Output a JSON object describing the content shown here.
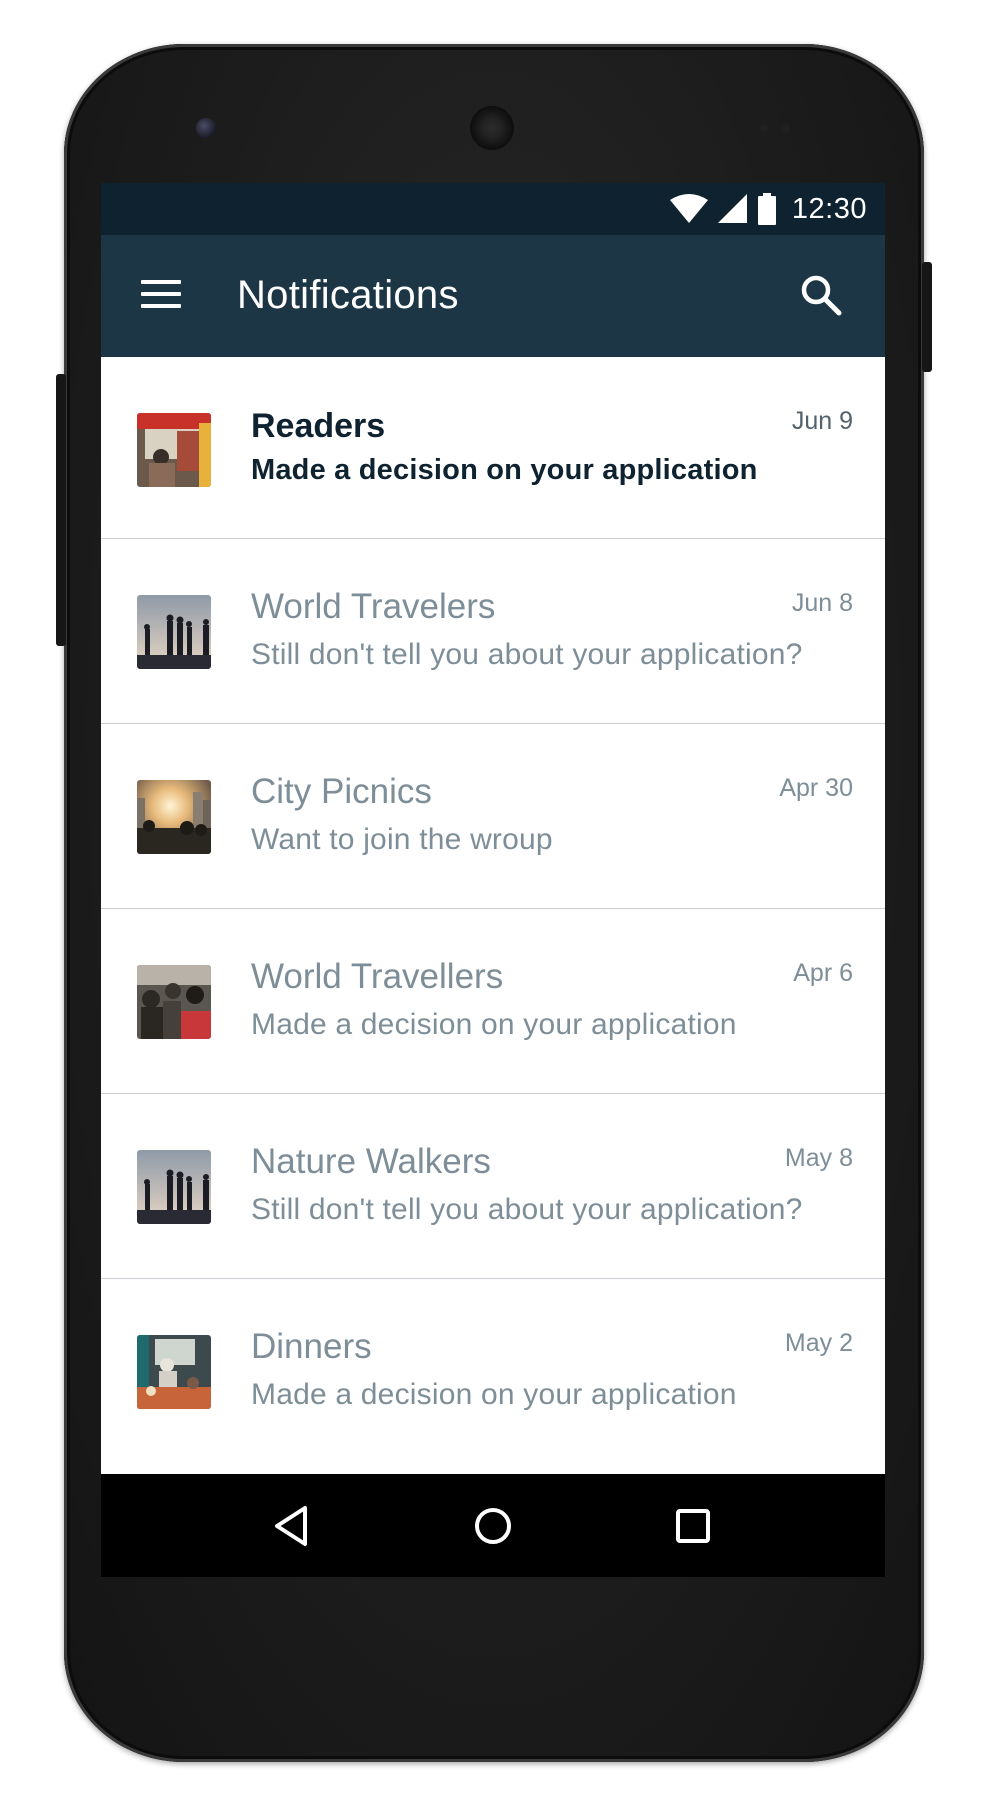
{
  "status_bar": {
    "time": "12:30",
    "icons": [
      "wifi-icon",
      "cell-signal-icon",
      "battery-icon"
    ]
  },
  "app_bar": {
    "title": "Notifications",
    "menu_icon": "hamburger-menu-icon",
    "search_icon": "search-icon",
    "background": "#1c3645"
  },
  "notifications": [
    {
      "title": "Readers",
      "message": "Made a decision on your application",
      "date": "Jun 9",
      "unread": true,
      "thumbnail": "bus-photo"
    },
    {
      "title": "World Travelers",
      "message": "Still don't tell you about your application?",
      "date": "Jun 8",
      "unread": false,
      "thumbnail": "group-silhouette-photo"
    },
    {
      "title": "City Picnics",
      "message": "Want to join the wroup",
      "date": "Apr 30",
      "unread": false,
      "thumbnail": "sunset-city-photo"
    },
    {
      "title": "World Travellers",
      "message": "Made a decision on your application",
      "date": "Apr 6",
      "unread": false,
      "thumbnail": "crowd-photo"
    },
    {
      "title": "Nature Walkers",
      "message": "Still don't tell you about your application?",
      "date": "May 8",
      "unread": false,
      "thumbnail": "group-silhouette-photo"
    },
    {
      "title": "Dinners",
      "message": "Made a decision on your application",
      "date": "May 2",
      "unread": false,
      "thumbnail": "dinner-table-photo"
    }
  ],
  "nav_bar": {
    "buttons": [
      "back-icon",
      "home-icon",
      "recents-icon"
    ]
  },
  "colors": {
    "status_bar": "#0f2230",
    "unread_text": "#0f2230",
    "read_text": "#7d8e98",
    "divider": "#c9ced2"
  }
}
